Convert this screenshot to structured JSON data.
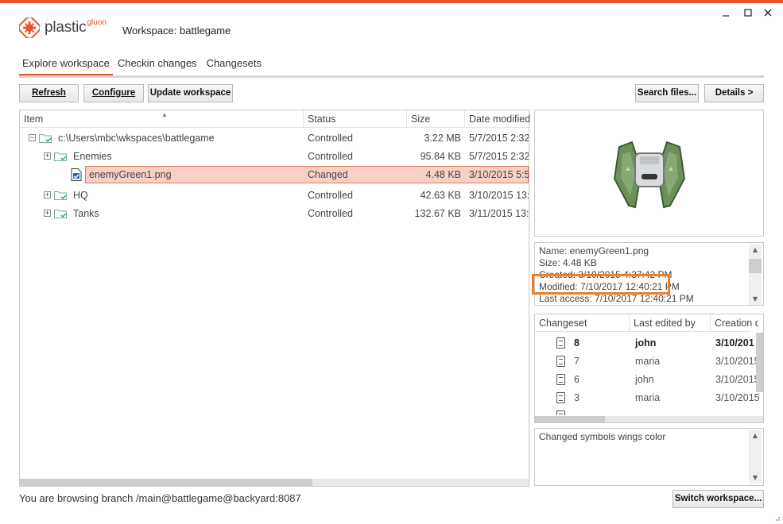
{
  "app": {
    "logo_text": "plastic",
    "logo_sup": "gluon",
    "workspace_title": "Workspace: battlegame",
    "accent": "#e8542a"
  },
  "window": {
    "minimize_icon": "minimize-icon",
    "maximize_icon": "maximize-icon",
    "close_icon": "close-icon"
  },
  "tabs": [
    {
      "label": "Explore workspace",
      "active": true
    },
    {
      "label": "Checkin changes",
      "active": false
    },
    {
      "label": "Changesets",
      "active": false
    }
  ],
  "toolbar": {
    "refresh": "Refresh",
    "configure": "Configure",
    "update_workspace": "Update workspace",
    "search_files": "Search files...",
    "details": "Details >"
  },
  "grid": {
    "columns": [
      "Item",
      "Status",
      "Size",
      "Date modified"
    ],
    "rows": [
      {
        "name": "c:\\Users\\mbc\\wkspaces\\battlegame",
        "status": "Controlled",
        "size": "3.22 MB",
        "date": "5/7/2015 2:32",
        "level": 0,
        "expander": "⊟",
        "type": "folder"
      },
      {
        "name": "Enemies",
        "status": "Controlled",
        "size": "95.84 KB",
        "date": "5/7/2015 2:32",
        "level": 1,
        "expander": "⊞",
        "type": "folder"
      },
      {
        "name": "enemyGreen1.png",
        "status": "Changed",
        "size": "4.48 KB",
        "date": "3/10/2015 5:5",
        "level": 2,
        "expander": "",
        "type": "file"
      },
      {
        "name": "HQ",
        "status": "Controlled",
        "size": "42.63 KB",
        "date": "3/10/2015 13:",
        "level": 1,
        "expander": "⊞",
        "type": "folder"
      },
      {
        "name": "Tanks",
        "status": "Controlled",
        "size": "132.67 KB",
        "date": "3/11/2015 13:",
        "level": 1,
        "expander": "⊞",
        "type": "folder"
      }
    ]
  },
  "details": {
    "name": "Name: enemyGreen1.png",
    "size": "Size: 4.48 KB",
    "created": "Created: 3/10/2015 4:37:42 PM",
    "modified": "Modified: 7/10/2017 12:40:21 PM",
    "last_access": "Last access: 7/10/2017 12:40:21 PM"
  },
  "changesets": {
    "columns": [
      "Changeset",
      "Last edited by",
      "Creation da"
    ],
    "rows": [
      {
        "id": "8",
        "user": "john",
        "date": "3/10/201",
        "bold": true
      },
      {
        "id": "7",
        "user": "maria",
        "date": "3/10/2015",
        "bold": false
      },
      {
        "id": "6",
        "user": "john",
        "date": "3/10/2015",
        "bold": false
      },
      {
        "id": "3",
        "user": "maria",
        "date": "3/10/2015",
        "bold": false
      }
    ]
  },
  "comment": "Changed symbols wings color",
  "status_bar": {
    "text": "You are browsing branch /main@battlegame@backyard:8087",
    "switch_workspace": "Switch workspace..."
  }
}
